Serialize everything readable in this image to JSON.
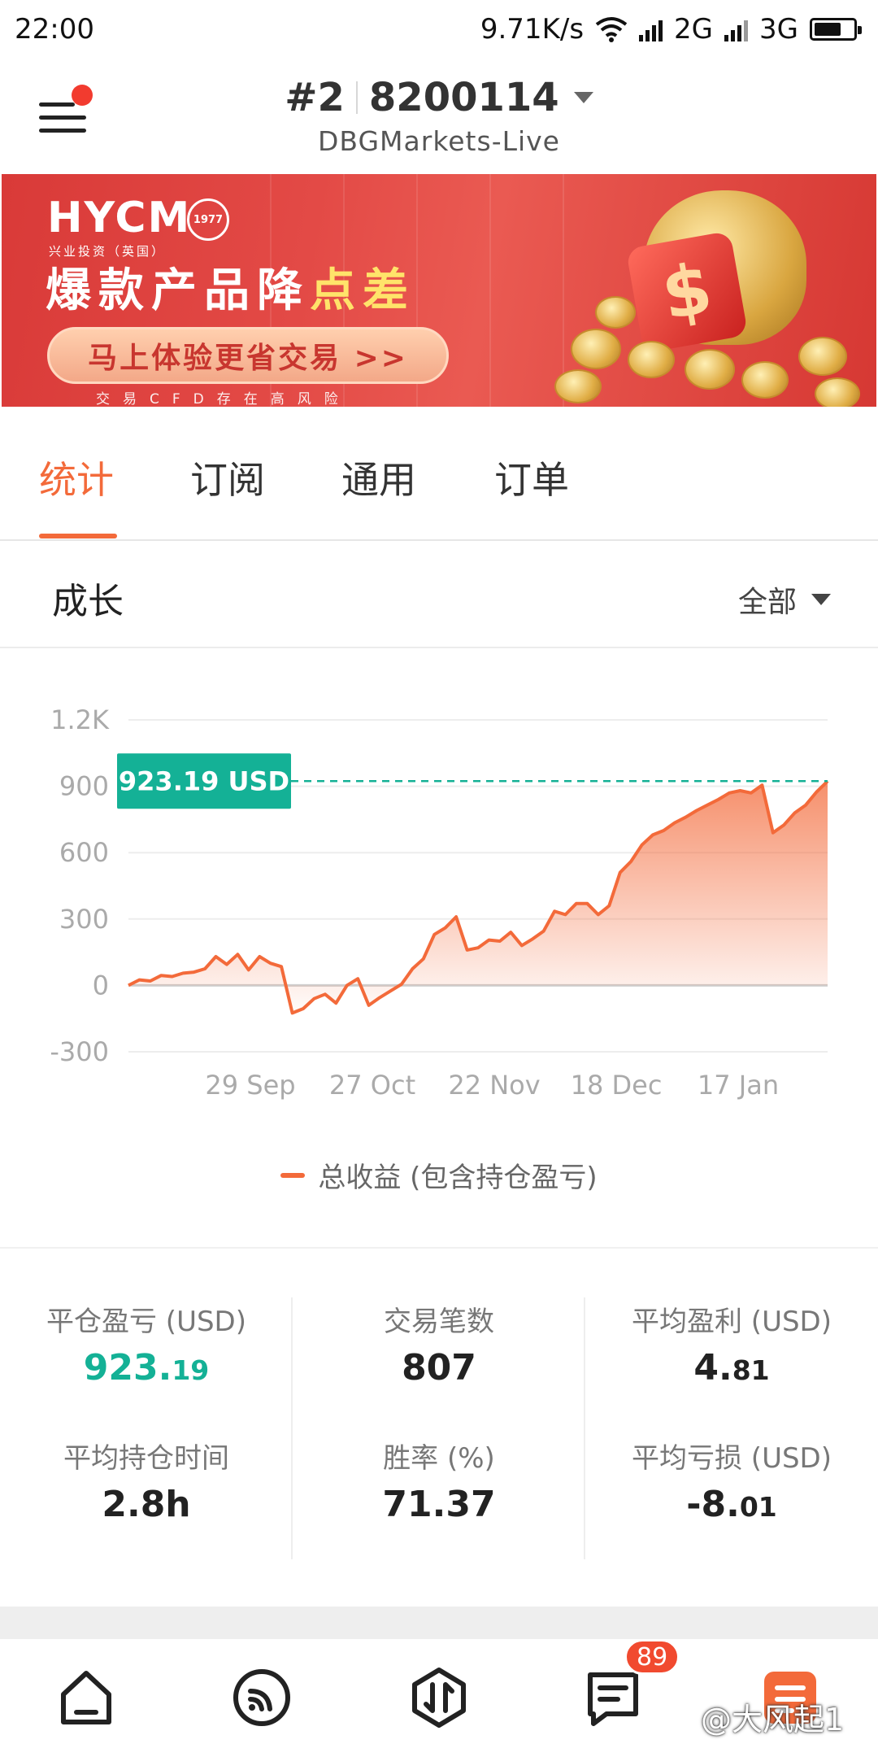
{
  "status": {
    "time": "22:00",
    "speed": "9.71K/s",
    "net1": "2G",
    "net2": "3G"
  },
  "header": {
    "account_num": "#2",
    "account_id": "8200114",
    "broker": "DBGMarkets-Live"
  },
  "banner": {
    "logo": "HYCM",
    "logo_sub": "兴业投资（英国）",
    "seal": "1977",
    "headline_main": "爆款产品降",
    "headline_highlight": "点差",
    "cta": "马上体验更省交易 >>",
    "risk": "交易CFD存在高风险"
  },
  "tabs": [
    "统计",
    "订阅",
    "通用",
    "订单"
  ],
  "growth": {
    "title": "成长",
    "range": "全部"
  },
  "chart_data": {
    "type": "area",
    "y_ticks": [
      "1.2K",
      "900",
      "600",
      "300",
      "0",
      "-300"
    ],
    "x_ticks": [
      "29 Sep",
      "27 Oct",
      "22 Nov",
      "18 Dec",
      "17 Jan"
    ],
    "ylim": [
      -300,
      1200
    ],
    "current_label": "923.19 USD",
    "current_value": 923.19,
    "series": [
      {
        "name": "总收益 (包含持仓盈亏)",
        "values": [
          0,
          25,
          20,
          45,
          40,
          55,
          60,
          75,
          130,
          95,
          140,
          70,
          130,
          100,
          85,
          -125,
          -105,
          -60,
          -40,
          -80,
          0,
          30,
          -90,
          -55,
          -25,
          5,
          75,
          120,
          230,
          260,
          310,
          160,
          170,
          205,
          200,
          240,
          180,
          210,
          245,
          335,
          320,
          370,
          370,
          320,
          360,
          510,
          560,
          635,
          680,
          700,
          735,
          760,
          790,
          815,
          840,
          870,
          880,
          870,
          905,
          690,
          725,
          780,
          815,
          875,
          923.19
        ]
      }
    ]
  },
  "stats": [
    {
      "label": "平仓盈亏 (USD)",
      "value_int": "923.",
      "value_dec": "19",
      "color": "green"
    },
    {
      "label": "交易笔数",
      "value_int": "807",
      "value_dec": ""
    },
    {
      "label": "平均盈利 (USD)",
      "value_int": "4.",
      "value_dec": "81"
    },
    {
      "label": "平均持仓时间",
      "value_int": "2.8h",
      "value_dec": ""
    },
    {
      "label": "胜率 (%)",
      "value_int": "71.37",
      "value_dec": ""
    },
    {
      "label": "平均亏损 (USD)",
      "value_int": "-8.",
      "value_dec": "01"
    }
  ],
  "nav": {
    "messages_badge": "89",
    "watermark": "@大风起1"
  },
  "colors": {
    "accent": "#f36a3a",
    "green": "#14b196",
    "badge": "#f14a2f"
  }
}
